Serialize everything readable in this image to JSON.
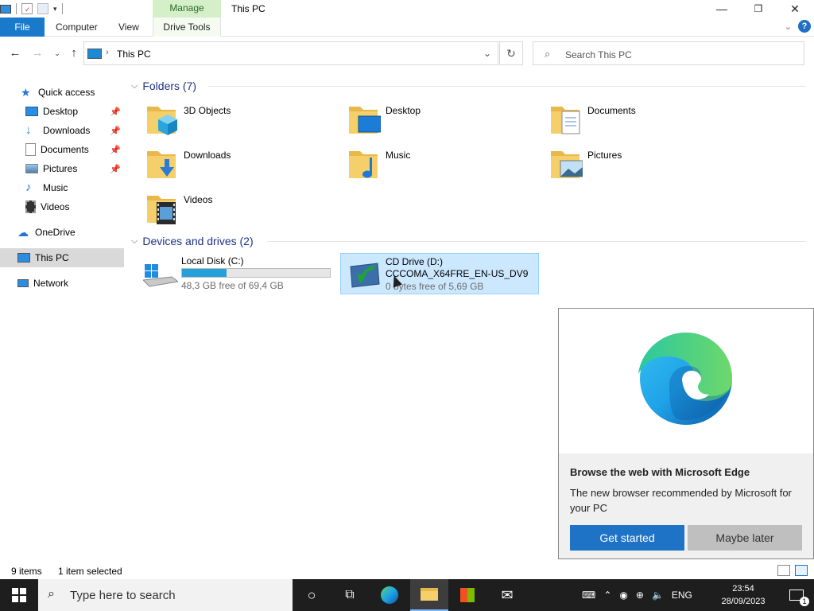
{
  "window": {
    "title": "This PC",
    "context_tab": "Manage",
    "controls": [
      "minimize",
      "maximize",
      "close"
    ]
  },
  "ribbon": {
    "tabs": [
      {
        "label": "File"
      },
      {
        "label": "Computer"
      },
      {
        "label": "View"
      },
      {
        "label": "Drive Tools"
      }
    ]
  },
  "nav": {
    "address": "This PC",
    "search_placeholder": "Search This PC"
  },
  "sidebar": {
    "items": [
      {
        "label": "Quick access",
        "icon": "star-icon"
      },
      {
        "label": "Desktop",
        "icon": "desktop-icon",
        "pinned": true
      },
      {
        "label": "Downloads",
        "icon": "download-icon",
        "pinned": true
      },
      {
        "label": "Documents",
        "icon": "documents-icon",
        "pinned": true
      },
      {
        "label": "Pictures",
        "icon": "pictures-icon",
        "pinned": true
      },
      {
        "label": "Music",
        "icon": "music-icon"
      },
      {
        "label": "Videos",
        "icon": "videos-icon"
      },
      {
        "label": "OneDrive",
        "icon": "cloud-icon"
      },
      {
        "label": "This PC",
        "icon": "computer-icon",
        "selected": true
      },
      {
        "label": "Network",
        "icon": "network-icon"
      }
    ]
  },
  "folders": {
    "header": "Folders (7)",
    "items": [
      {
        "label": "3D Objects"
      },
      {
        "label": "Desktop"
      },
      {
        "label": "Documents"
      },
      {
        "label": "Downloads"
      },
      {
        "label": "Music"
      },
      {
        "label": "Pictures"
      },
      {
        "label": "Videos"
      }
    ]
  },
  "drives": {
    "header": "Devices and drives (2)",
    "items": [
      {
        "name": "Local Disk (C:)",
        "free": "48,3 GB free of 69,4 GB",
        "used_fraction": 0.3
      },
      {
        "name": "CD Drive (D:)",
        "label": "CCCOMA_X64FRE_EN-US_DV9",
        "free": "0 bytes free of 5,69 GB",
        "selected": true
      }
    ]
  },
  "status": {
    "items_count": "9 items",
    "selection": "1 item selected"
  },
  "edge_popup": {
    "title": "Browse the web with Microsoft Edge",
    "body": "The new browser recommended by Microsoft for your PC",
    "primary_button": "Get started",
    "secondary_button": "Maybe later"
  },
  "taskbar": {
    "search_placeholder": "Type here to search",
    "language": "ENG",
    "time": "23:54",
    "date": "28/09/2023",
    "notifications": "1"
  }
}
